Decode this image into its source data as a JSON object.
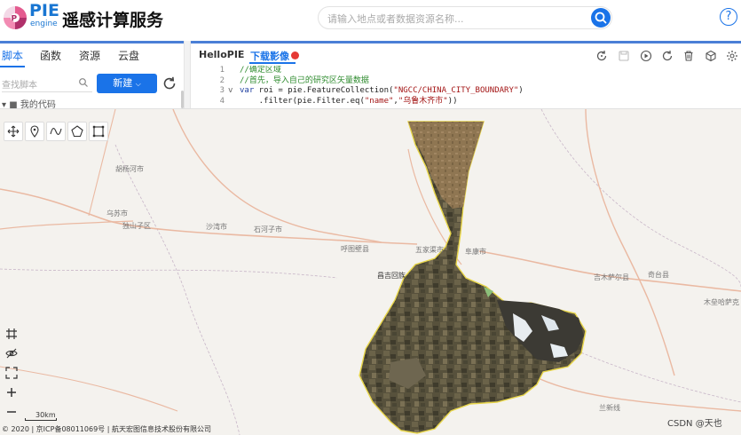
{
  "header": {
    "logo_pie": "PIE",
    "logo_engine": "engine",
    "brand": "遥感计算服务",
    "search_placeholder": "请输入地点或者数据资源名称...",
    "help": "?"
  },
  "left_panel": {
    "tabs": [
      {
        "label": "脚本",
        "active": true
      },
      {
        "label": "函数",
        "active": false
      },
      {
        "label": "资源",
        "active": false
      },
      {
        "label": "云盘",
        "active": false
      }
    ],
    "search_placeholder": "查找脚本",
    "new_button": "新建",
    "tree_item": "我的代码"
  },
  "editor": {
    "tabs": [
      {
        "label": "HelloPIE",
        "active": false
      },
      {
        "label": "下载影像",
        "active": true
      }
    ],
    "toolbar_icons": [
      "refresh-icon",
      "save-icon",
      "run-icon",
      "stop-icon",
      "delete-icon",
      "cube-icon",
      "settings-icon"
    ],
    "code_lines": [
      {
        "num": "1",
        "fold": "",
        "parts": [
          {
            "t": "cm",
            "v": "//确定区域"
          }
        ]
      },
      {
        "num": "2",
        "fold": "",
        "parts": [
          {
            "t": "cm",
            "v": "//首先，导入自己的研究区矢量数据"
          }
        ]
      },
      {
        "num": "3",
        "fold": "v",
        "parts": [
          {
            "t": "kw",
            "v": "var"
          },
          {
            "t": "txt",
            "v": " roi = pie.FeatureCollection("
          },
          {
            "t": "str",
            "v": "\"NGCC/CHINA_CITY_BOUNDARY\""
          },
          {
            "t": "txt",
            "v": ")"
          }
        ]
      },
      {
        "num": "4",
        "fold": "",
        "parts": [
          {
            "t": "txt",
            "v": "    .filter(pie.Filter.eq("
          },
          {
            "t": "str",
            "v": "\"name\""
          },
          {
            "t": "txt",
            "v": ","
          },
          {
            "t": "str",
            "v": "\"乌鲁木齐市\""
          },
          {
            "t": "txt",
            "v": "))"
          }
        ]
      }
    ]
  },
  "map": {
    "labels": [
      {
        "name": "胡杨河市",
        "id": "label-huyanghe"
      },
      {
        "name": "乌苏市",
        "id": "label-wusu"
      },
      {
        "name": "独山子区",
        "id": "label-dushanzi"
      },
      {
        "name": "沙湾市",
        "id": "label-shawan"
      },
      {
        "name": "石河子市",
        "id": "label-shihezi"
      },
      {
        "name": "呼图壁县",
        "id": "label-hutubi"
      },
      {
        "name": "五家渠市",
        "id": "label-wujiaqu"
      },
      {
        "name": "阜康市",
        "id": "label-fukang"
      },
      {
        "name": "昌吉回族",
        "id": "label-changji"
      },
      {
        "name": "吉木萨尔县",
        "id": "label-jimusaer"
      },
      {
        "name": "奇台县",
        "id": "label-qitai"
      },
      {
        "name": "木垒哈萨克",
        "id": "label-mulei"
      },
      {
        "name": "兰新线",
        "id": "label-lanxin"
      }
    ],
    "scale_label": "30km",
    "copyright": "© 2020 | 京ICP备08011069号 | 航天宏图信息技术股份有限公司",
    "watermark": "CSDN @天也"
  }
}
